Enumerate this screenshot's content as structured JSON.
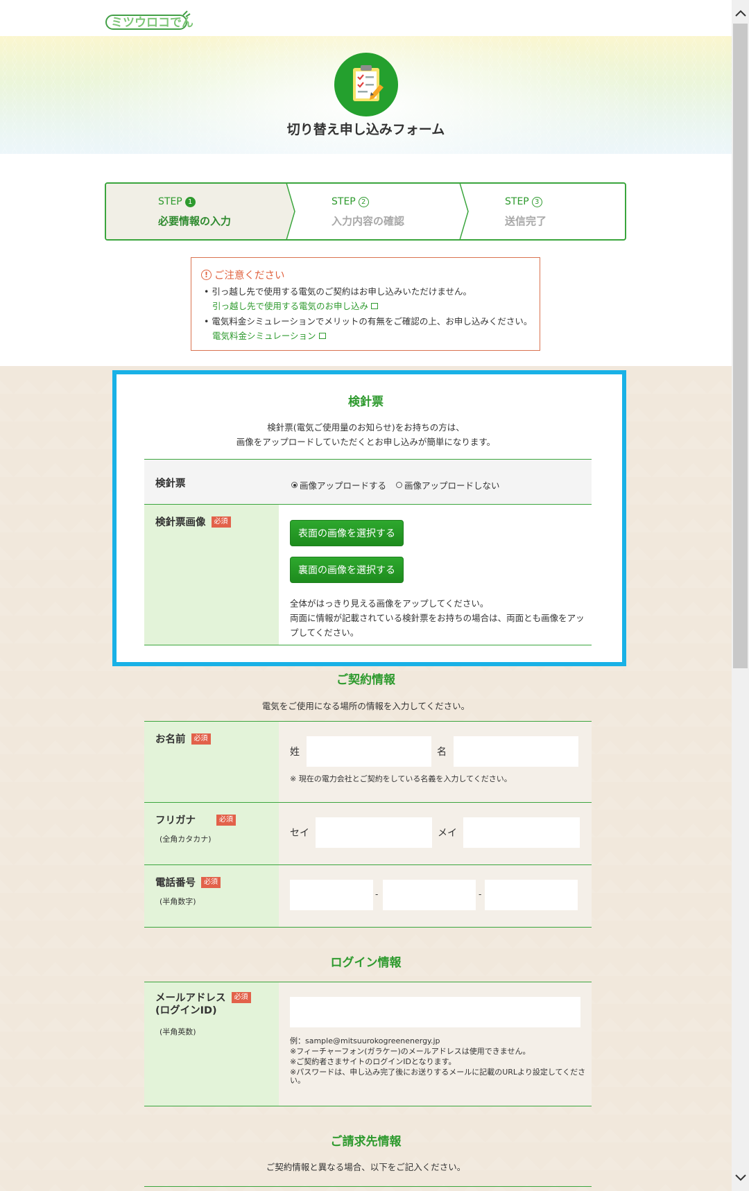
{
  "logo": {
    "text": "ミツウロコでんき"
  },
  "form_title": "切り替え申し込みフォーム",
  "steps": [
    {
      "label": "STEP",
      "num": "1",
      "title": "必要情報の入力"
    },
    {
      "label": "STEP",
      "num": "2",
      "title": "入力内容の確認"
    },
    {
      "label": "STEP",
      "num": "3",
      "title": "送信完了"
    }
  ],
  "notice": {
    "title": "ご注意ください",
    "item1": "引っ越し先で使用する電気のご契約はお申し込みいただけません。",
    "link1": "引っ越し先で使用する電気のお申し込み",
    "item2": "電気料金シミュレーションでメリットの有無をご確認の上、お申し込みください。",
    "link2": "電気料金シミュレーション"
  },
  "meter": {
    "title": "検針票",
    "desc1": "検針票(電気ご使用量のお知らせ)をお持ちの方は、",
    "desc2": "画像をアップロードしていただくとお申し込みが簡単になります。",
    "row_label": "検針票",
    "radio_upload": "画像アップロードする",
    "radio_no_upload": "画像アップロードしない",
    "image_label": "検針票画像",
    "required": "必須",
    "front_button": "表面の画像を選択する",
    "back_button": "裏面の画像を選択する",
    "note1": "全体がはっきり見える画像をアップしてください。",
    "note2": "両面に情報が記載されている検針票をお持ちの場合は、両面とも画像をアッ",
    "note3": "プしてください。"
  },
  "contract": {
    "title": "ご契約情報",
    "desc": "電気をご使用になる場所の情報を入力してください。",
    "name_label": "お名前",
    "last_name": "姓",
    "first_name": "名",
    "name_note": "※ 現在の電力会社とご契約をしている名義を入力してください。",
    "kana_label": "フリガナ",
    "kana_sub": "(全角カタカナ)",
    "sei": "セイ",
    "mei": "メイ",
    "phone_label": "電話番号",
    "phone_sub": "(半角数字)",
    "dash": "-"
  },
  "login": {
    "title": "ログイン情報",
    "email_label1": "メールアドレス",
    "email_label2": "(ログインID)",
    "email_sub": "(半角英数)",
    "note1": "例：sample@mitsuurokogreenenergy.jp",
    "note2": "※フィーチャーフォン(ガラケー)のメールアドレスは使用できません。",
    "note3": "※ご契約者さまサイトのログインIDとなります。",
    "note4": "※パスワードは、申し込み完了後にお送りするメールに記載のURLより設定してくださ",
    "note5": "い。"
  },
  "billing": {
    "title": "ご請求先情報",
    "desc": "ご契約情報と異なる場合、以下をご記入ください。"
  },
  "colors": {
    "accent_green": "#2e9a2e",
    "highlight_blue": "#19b1e6",
    "required_red": "#e2614a",
    "notice_orange": "#e0613e"
  }
}
